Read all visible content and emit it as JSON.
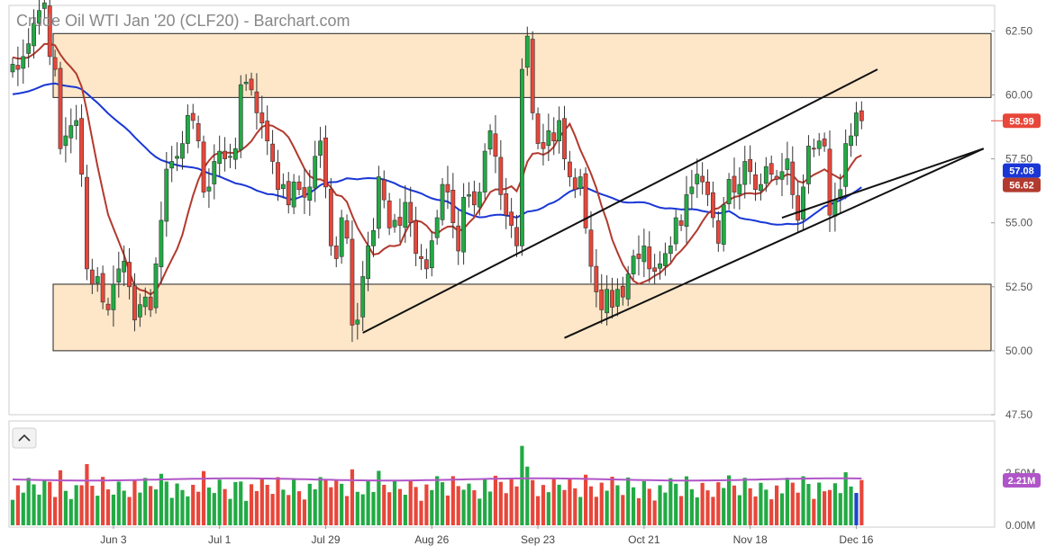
{
  "chart_data": {
    "type": "candlestick",
    "title": "Crude Oil WTI Jan '20 (CLF20) - Barchart.com",
    "price_axis": {
      "ylim": [
        47.5,
        63.5
      ],
      "ticks": [
        47.5,
        50.0,
        52.5,
        55.0,
        57.5,
        60.0,
        62.5
      ],
      "tick_labels": [
        "47.50",
        "50.00",
        "52.50",
        "55.00",
        "57.50",
        "60.00",
        "62.50"
      ]
    },
    "x_tick_labels": [
      {
        "label": "Jun 3",
        "index": 19
      },
      {
        "label": "Jul 1",
        "index": 39
      },
      {
        "label": "Jul 29",
        "index": 59
      },
      {
        "label": "Aug 26",
        "index": 79
      },
      {
        "label": "Sep 23",
        "index": 99
      },
      {
        "label": "Oct 21",
        "index": 119
      },
      {
        "label": "Nov 18",
        "index": 139
      },
      {
        "label": "Dec 16",
        "index": 159
      }
    ],
    "index_range": [
      0,
      163
    ],
    "closes": [
      61.2,
      61.0,
      61.5,
      62.0,
      62.8,
      63.3,
      63.6,
      61.5,
      61.0,
      57.9,
      58.4,
      58.8,
      59.0,
      56.9,
      53.2,
      52.6,
      52.9,
      51.9,
      51.6,
      52.6,
      53.2,
      53.5,
      52.5,
      51.2,
      51.8,
      52.1,
      51.6,
      53.4,
      55.1,
      57.1,
      57.4,
      57.6,
      58.1,
      59.2,
      59.0,
      58.2,
      56.2,
      56.4,
      57.4,
      57.8,
      57.5,
      57.6,
      57.9,
      60.4,
      60.5,
      60.2,
      59.3,
      58.9,
      58.2,
      57.4,
      56.3,
      56.5,
      55.7,
      56.6,
      56.3,
      56.0,
      56.4,
      57.6,
      58.2,
      56.4,
      54.1,
      53.6,
      55.2,
      54.4,
      51.0,
      51.2,
      52.9,
      54.1,
      54.7,
      56.8,
      55.9,
      54.8,
      55.1,
      54.9,
      55.8,
      55.0,
      53.8,
      53.6,
      53.2,
      54.3,
      55.2,
      56.5,
      56.2,
      55.0,
      53.9,
      56.0,
      56.1,
      55.7,
      56.2,
      57.8,
      58.6,
      57.6,
      56.1,
      55.3,
      54.9,
      54.1,
      61.0,
      62.3,
      59.3,
      58.1,
      57.9,
      58.6,
      58.2,
      59.0,
      57.5,
      56.8,
      56.3,
      56.8,
      54.8,
      53.3,
      52.3,
      51.6,
      52.4,
      51.7,
      52.4,
      52.1,
      53.0,
      53.7,
      53.6,
      54.1,
      53.2,
      53.1,
      53.4,
      53.8,
      54.1,
      55.2,
      54.9,
      56.1,
      56.4,
      56.9,
      56.6,
      56.1,
      55.2,
      54.2,
      55.7,
      56.7,
      56.2,
      56.5,
      57.4,
      57.0,
      56.3,
      56.5,
      57.2,
      56.9,
      56.7,
      57.0,
      57.5,
      56.1,
      55.1,
      56.4,
      58.0,
      57.9,
      58.2,
      58.0,
      55.3,
      55.9,
      56.3,
      58.1,
      58.4,
      59.3,
      58.99
    ],
    "last_price": "58.99",
    "ma_50_last": "56.62",
    "ma_200_last": "57.08",
    "zones": [
      {
        "low": 59.9,
        "high": 62.4
      },
      {
        "low": 50.0,
        "high": 52.6
      }
    ],
    "trendlines": [
      {
        "from": [
          66,
          50.7
        ],
        "to": [
          163,
          61.0
        ]
      },
      {
        "from": [
          104,
          50.5
        ],
        "to": [
          183,
          57.9
        ]
      },
      {
        "from": [
          145,
          55.2
        ],
        "to": [
          183,
          57.9
        ]
      }
    ],
    "volume_axis": {
      "labels": [
        "0.00M",
        "2.21M",
        "2.50M"
      ]
    },
    "volume_last": "2.21M",
    "colors": {
      "up": "#22aa44",
      "down": "#e8463a",
      "ma50": "#b23a2e",
      "ma200": "#1a37d6",
      "volume_ma": "#b055c8",
      "zone": "#fde7c8",
      "badge_last": "#e8463a",
      "badge_ma200": "#1a37d6",
      "badge_ma50": "#b23a2e",
      "badge_vol": "#b055c8"
    }
  },
  "ui": {
    "collapse_icon": "chevron-up-icon"
  }
}
